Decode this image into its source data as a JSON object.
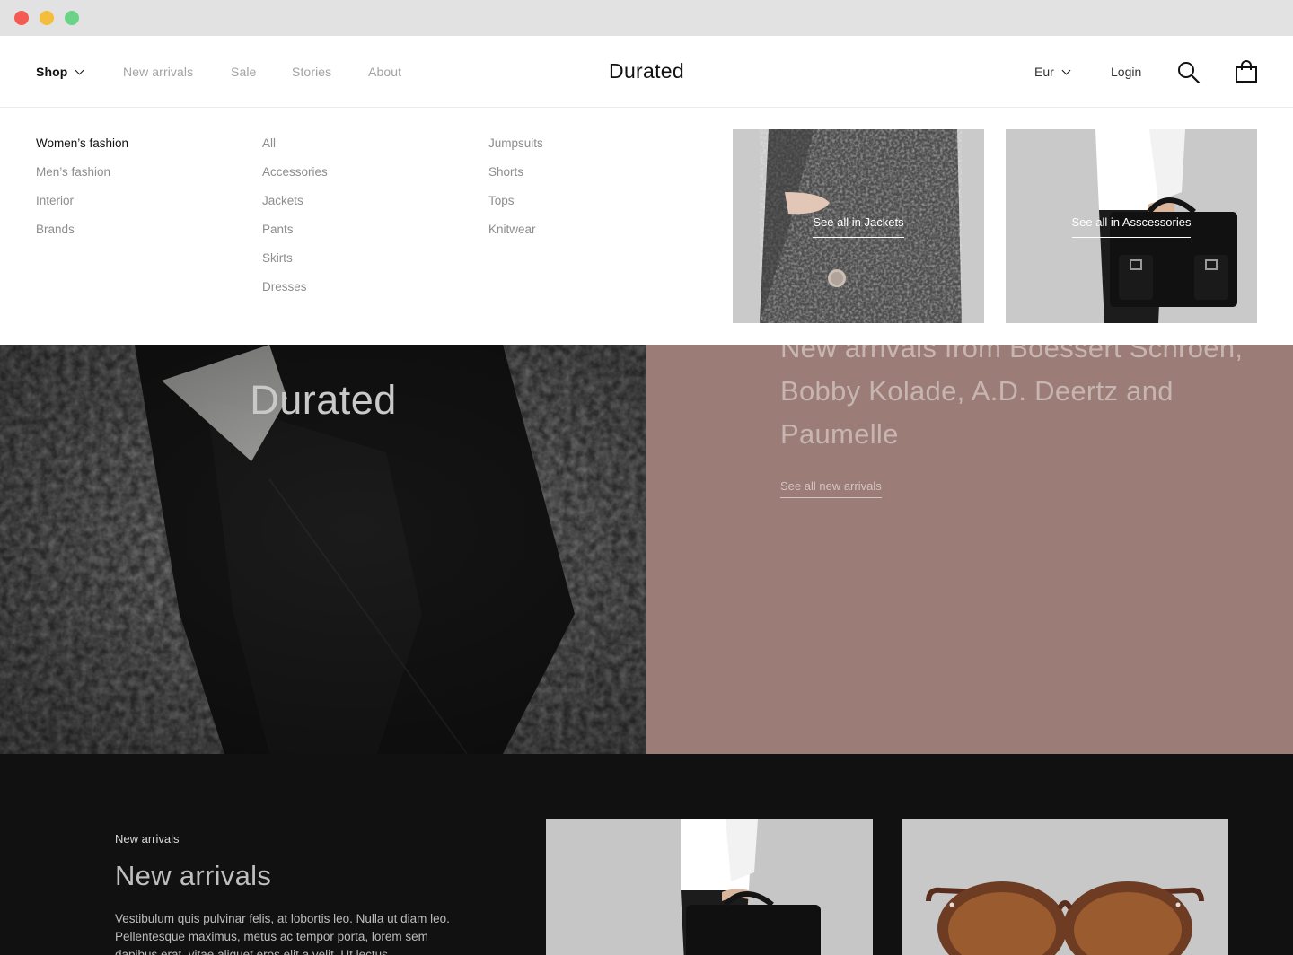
{
  "header": {
    "nav": [
      {
        "label": "Shop"
      },
      {
        "label": "New arrivals"
      },
      {
        "label": "Sale"
      },
      {
        "label": "Stories"
      },
      {
        "label": "About"
      }
    ],
    "logo": "Durated",
    "currency": "Eur",
    "login": "Login"
  },
  "mega_menu": {
    "categories": [
      "Women’s fashion",
      "Men’s fashion",
      "Interior",
      "Brands"
    ],
    "subcategories_1": [
      "All",
      "Accessories",
      "Jackets",
      "Pants",
      "Skirts",
      "Dresses"
    ],
    "subcategories_2": [
      "Jumpsuits",
      "Shorts",
      "Tops",
      "Knitwear"
    ],
    "promos": [
      {
        "link": "See all in Jackets"
      },
      {
        "link": "See all in Asscessories"
      }
    ]
  },
  "hero": {
    "brand": "Durated",
    "heading": "New arrivals from Boessert Schroen, Bobby Kolade, A.D. Deertz and Paumelle",
    "link": "See all new arrivals"
  },
  "section": {
    "eyebrow": "New arrivals",
    "title": "New arrivals",
    "body": "Vestibulum quis pulvinar felis, at lobortis leo. Nulla ut diam leo. Pellentesque maximus, metus ac tempor porta, lorem sem dapibus erat, vitae aliquet eros elit a velit. Ut lectus"
  },
  "colors": {
    "hero_right_bg": "#9b7c76",
    "dark_section_bg": "#111111",
    "chrome_bg": "#e2e2e2"
  }
}
